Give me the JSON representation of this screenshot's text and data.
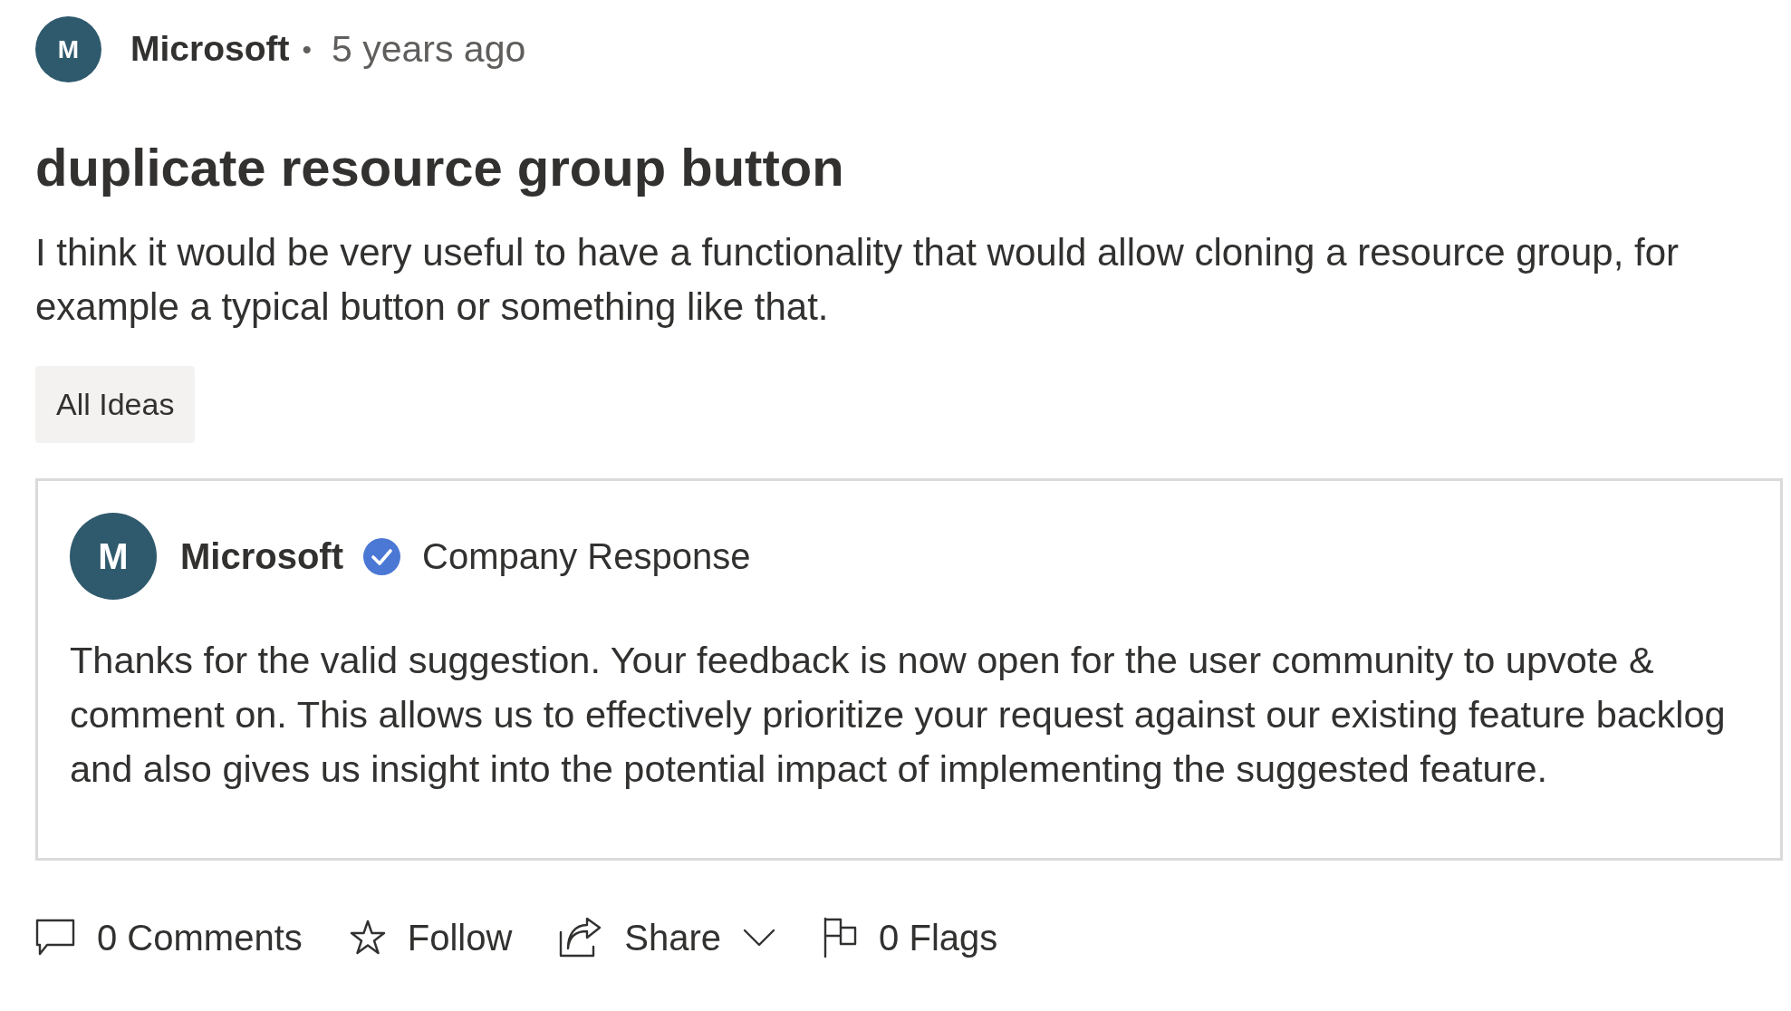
{
  "post": {
    "author": {
      "initial": "M",
      "name": "Microsoft"
    },
    "separator": "•",
    "time": "5 years ago",
    "title": "duplicate resource group button",
    "body": "I think it would be very useful to have a functionality that would allow cloning a resource group, for example a typical button or something like that.",
    "tags": [
      {
        "label": "All Ideas"
      }
    ]
  },
  "response": {
    "author": {
      "initial": "M",
      "name": "Microsoft",
      "verified": true
    },
    "label": "Company Response",
    "body": "Thanks for the valid suggestion. Your feedback is now open for the user community to upvote & comment on. This allows us to effectively prioritize your request against our existing feature backlog and also gives us insight into the potential impact of implementing the suggested feature."
  },
  "actions": [
    {
      "kind": "comments",
      "label": "0 Comments",
      "dropdown": false
    },
    {
      "kind": "follow",
      "label": "Follow",
      "dropdown": false
    },
    {
      "kind": "share",
      "label": "Share",
      "dropdown": true
    },
    {
      "kind": "flags",
      "label": "0 Flags",
      "dropdown": false
    }
  ]
}
